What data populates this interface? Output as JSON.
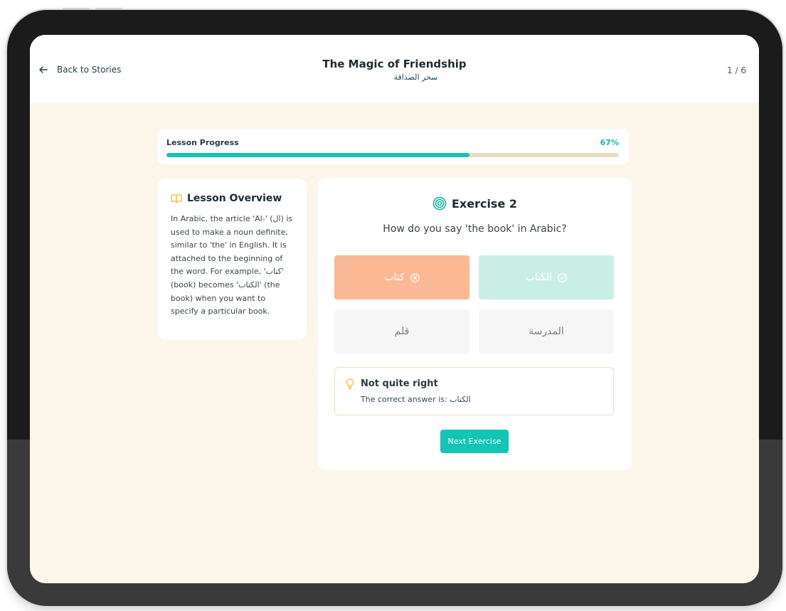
{
  "header": {
    "back_label": "Back to Stories",
    "title": "The Magic of Friendship",
    "subtitle": "سحر الصداقة",
    "pager": "1 / 6"
  },
  "progress": {
    "label": "Lesson Progress",
    "percent_label": "67%",
    "value": 0.67
  },
  "overview": {
    "title": "Lesson Overview",
    "icon": "book-open-icon",
    "text": "In Arabic, the article 'Al-' (ال) is used to make a noun definite, similar to 'the' in English. It is attached to the beginning of the word. For example, 'كتاب' (book) becomes 'الكتاب' (the book) when you want to specify a particular book."
  },
  "exercise": {
    "title": "Exercise 2",
    "icon": "target-icon",
    "question": "How do you say 'the book' in Arabic?",
    "options": [
      {
        "label": "كتاب",
        "state": "incorrect-selected",
        "icon": "x-circle-icon"
      },
      {
        "label": "الكتاب",
        "state": "correct",
        "icon": "check-circle-icon"
      },
      {
        "label": "قلم",
        "state": "neutral"
      },
      {
        "label": "المدرسة",
        "state": "neutral"
      }
    ],
    "feedback": {
      "icon": "lightbulb-icon",
      "title": "Not quite right",
      "text_prefix": "The correct answer is:",
      "answer": "الكتاب"
    },
    "next_label": "Next Exercise"
  },
  "colors": {
    "accent": "#14c4b4",
    "background": "#fcf5e9",
    "wrong": "#fbb894",
    "right": "#c9eee6",
    "lightbulb": "#f5b82e"
  }
}
